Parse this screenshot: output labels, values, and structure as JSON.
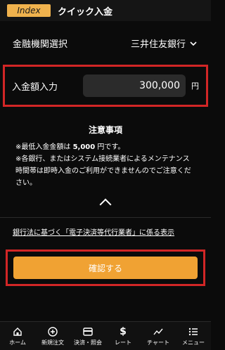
{
  "header": {
    "index_label": "Index",
    "title": "クイック入金"
  },
  "bank": {
    "label": "金融機関選択",
    "selected": "三井住友銀行",
    "chevron": "chevron-down-icon"
  },
  "amount": {
    "label": "入金額入力",
    "value": "300,000",
    "unit": "円"
  },
  "notice": {
    "title": "注意事項",
    "line1_prefix": "※最低入金金額は ",
    "line1_value": "5,000",
    "line1_suffix": " 円です。",
    "line2": "※各銀行、またはシステム接続業者によるメンテナンス時間帯は即時入金のご利用ができませんのでご注意ください。"
  },
  "legal_link": "銀行法に基づく「電子決済等代行業者」に係る表示",
  "confirm": {
    "label": "確認する"
  },
  "nav": [
    {
      "label": "ホーム",
      "icon": "home-icon"
    },
    {
      "label": "新規注文",
      "icon": "new-order-icon"
    },
    {
      "label": "決済・照会",
      "icon": "card-icon"
    },
    {
      "label": "レート",
      "icon": "dollar-icon"
    },
    {
      "label": "チャート",
      "icon": "chart-icon"
    },
    {
      "label": "メニュー",
      "icon": "menu-icon"
    }
  ],
  "colors": {
    "accent": "#f0a233",
    "highlight": "#d22626",
    "background": "#0b0b0b"
  }
}
